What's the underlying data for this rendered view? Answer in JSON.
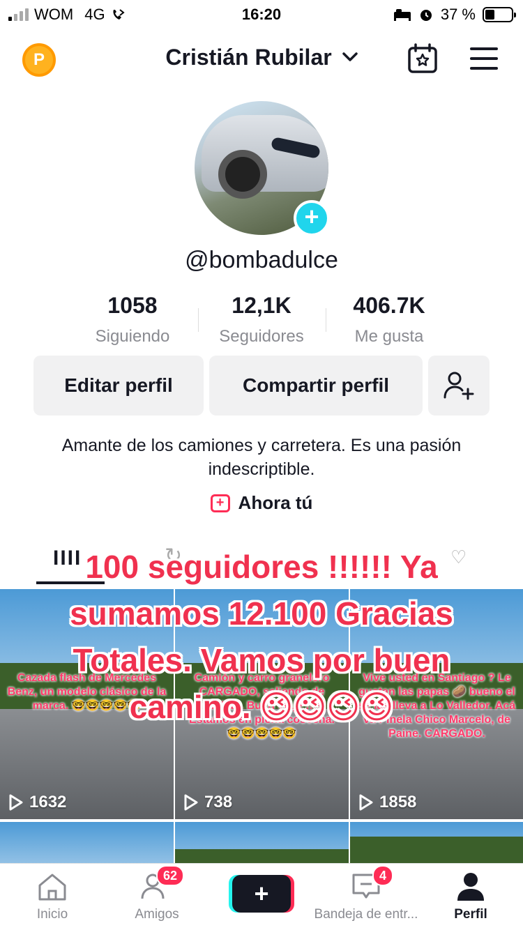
{
  "status_bar": {
    "carrier": "WOM",
    "network": "4G",
    "time": "16:20",
    "battery_percent": "37 %",
    "battery_level": 0.37
  },
  "header": {
    "coin_label": "P",
    "profile_name": "Cristián Rubilar",
    "chevron": "chevron-down-icon",
    "calendar": "calendar-star-icon",
    "menu": "menu-icon"
  },
  "profile": {
    "username": "@bombadulce",
    "add_avatar_symbol": "+"
  },
  "stats": [
    {
      "value": "1058",
      "label": "Siguiendo"
    },
    {
      "value": "12,1K",
      "label": "Seguidores"
    },
    {
      "value": "406.7K",
      "label": "Me gusta"
    }
  ],
  "actions": {
    "edit_profile": "Editar perfil",
    "share_profile": "Compartir perfil",
    "add_friend_icon": "add-user-icon"
  },
  "bio": "Amante de los camiones y carretera. Es una pasión indescriptible.",
  "ahora": {
    "label": "Ahora tú",
    "icon_symbol": "+"
  },
  "tabs": {
    "videos_icon": "IIII",
    "repost_icon": "↻",
    "liked_icon": "♡"
  },
  "overlay_text": "100 seguidores !!!!!! Ya sumamos 12.100  Gracias Totales. Vamos por buen camino. 😉😉😉😉",
  "videos": [
    {
      "caption": "Cazada flash de Mercedes Benz, un modelo clásico de la marca. 🤓🤓🤓🤓🤓",
      "views": "1632"
    },
    {
      "caption": "Camión y carro granelero CARGADO, saliendo de Chillán. Buen viaje !!!! Estamos en plena cosecha. 🤓🤓🤓🤓🤓",
      "views": "738"
    },
    {
      "caption": "Vive usted en Santiago ? Le gustan las papas 🥔 bueno el se las lleva a Lo Valledor. Acá va Pinela Chico Marcelo, de Paine. CARGADO.",
      "views": "1858"
    }
  ],
  "bottom_nav": {
    "home": "Inicio",
    "friends": "Amigos",
    "friends_badge": "62",
    "create": "+",
    "inbox": "Bandeja de entr...",
    "inbox_badge": "4",
    "profile": "Perfil"
  },
  "colors": {
    "accent": "#fe2c55",
    "cyan": "#20d5ec",
    "coin": "#ffb21f",
    "overlay_text": "#f0314f"
  }
}
